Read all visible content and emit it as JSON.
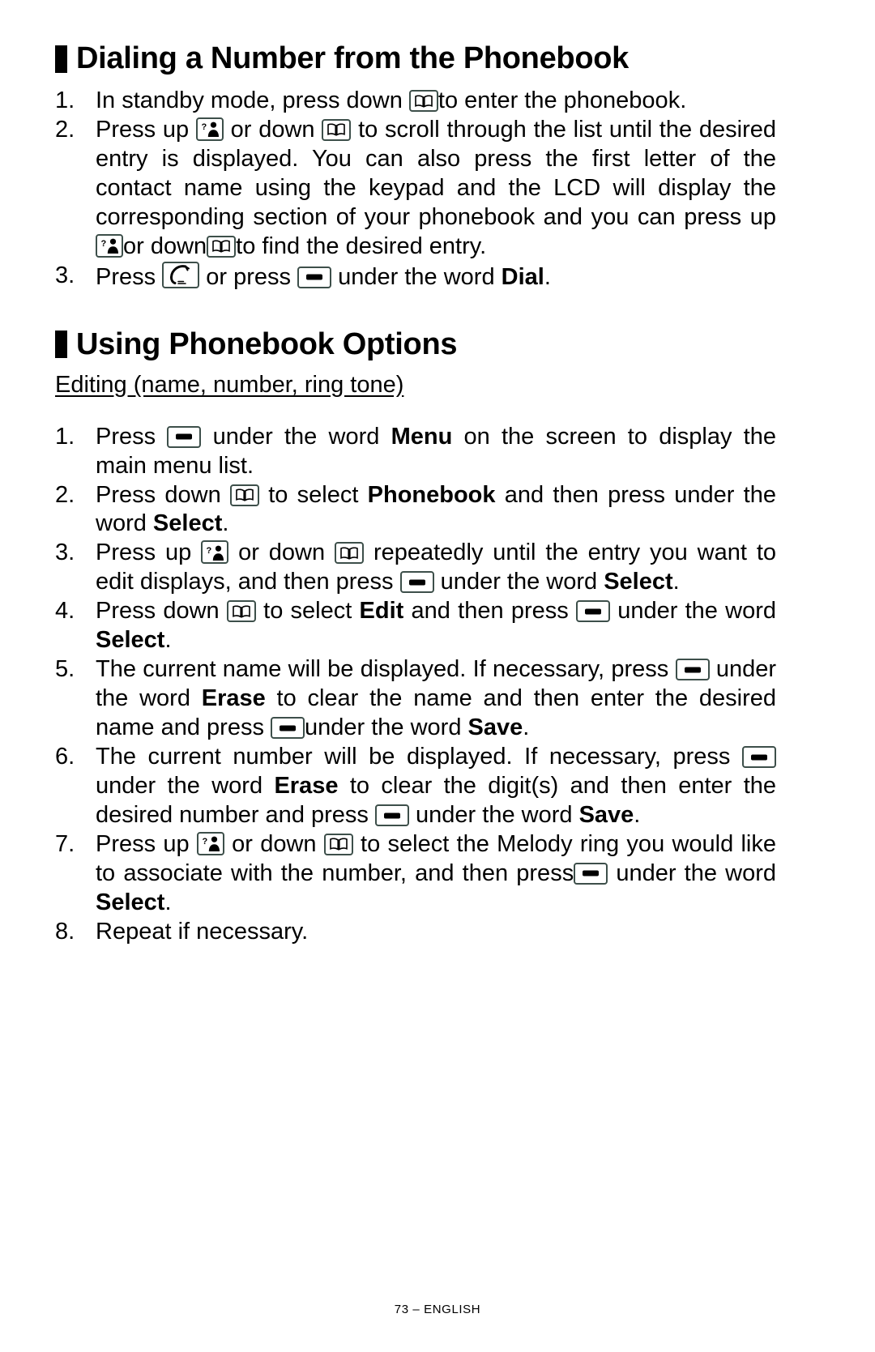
{
  "page": {
    "footer": "73 – ENGLISH"
  },
  "section1": {
    "heading": "Dialing a Number from the Phonebook",
    "steps": [
      {
        "num": "1.",
        "parts": [
          {
            "t": "text",
            "v": "In standby mode, press down "
          },
          {
            "t": "icon",
            "v": "phonebook-down-key"
          },
          {
            "t": "text",
            "v": "to enter the phonebook."
          }
        ]
      },
      {
        "num": "2.",
        "parts": [
          {
            "t": "text",
            "v": "Press up "
          },
          {
            "t": "icon",
            "v": "callerid-up-key"
          },
          {
            "t": "text",
            "v": " or down "
          },
          {
            "t": "icon",
            "v": "phonebook-down-key"
          },
          {
            "t": "text",
            "v": " to scroll through the list until the desired entry is displayed. You can also press the first letter of the contact name using the keypad and the LCD will display the corresponding section of your phonebook and you can press up"
          },
          {
            "t": "icon",
            "v": "callerid-up-key"
          },
          {
            "t": "text",
            "v": "or down"
          },
          {
            "t": "icon",
            "v": "phonebook-down-key"
          },
          {
            "t": "text",
            "v": "to find the desired entry."
          }
        ]
      },
      {
        "num": "3.",
        "parts": [
          {
            "t": "text",
            "v": "Press "
          },
          {
            "t": "icon",
            "v": "talk-key"
          },
          {
            "t": "text",
            "v": " or press "
          },
          {
            "t": "icon",
            "v": "soft-key"
          },
          {
            "t": "text",
            "v": " under the word "
          },
          {
            "t": "bold",
            "v": "Dial"
          },
          {
            "t": "text",
            "v": "."
          }
        ]
      }
    ]
  },
  "section2": {
    "heading": "Using Phonebook Options",
    "subheading": "Editing (name, number, ring tone)",
    "steps": [
      {
        "num": "1.",
        "parts": [
          {
            "t": "text",
            "v": "Press "
          },
          {
            "t": "icon",
            "v": "soft-key"
          },
          {
            "t": "text",
            "v": " under the word "
          },
          {
            "t": "bold",
            "v": "Menu"
          },
          {
            "t": "text",
            "v": " on the screen to display the main menu list."
          }
        ]
      },
      {
        "num": "2.",
        "parts": [
          {
            "t": "text",
            "v": "Press down "
          },
          {
            "t": "icon",
            "v": "phonebook-down-key"
          },
          {
            "t": "text",
            "v": " to select "
          },
          {
            "t": "bold",
            "v": "Phonebook"
          },
          {
            "t": "text",
            "v": " and then press under the word "
          },
          {
            "t": "bold",
            "v": "Select"
          },
          {
            "t": "text",
            "v": "."
          }
        ]
      },
      {
        "num": "3.",
        "parts": [
          {
            "t": "text",
            "v": "Press up "
          },
          {
            "t": "icon",
            "v": "callerid-up-key"
          },
          {
            "t": "text",
            "v": " or down "
          },
          {
            "t": "icon",
            "v": "phonebook-down-key"
          },
          {
            "t": "text",
            "v": " repeatedly until the entry you want to edit displays, and then press "
          },
          {
            "t": "icon",
            "v": "soft-key"
          },
          {
            "t": "text",
            "v": " under the word "
          },
          {
            "t": "bold",
            "v": "Select"
          },
          {
            "t": "text",
            "v": "."
          }
        ]
      },
      {
        "num": "4.",
        "parts": [
          {
            "t": "text",
            "v": "Press down "
          },
          {
            "t": "icon",
            "v": "phonebook-down-key"
          },
          {
            "t": "text",
            "v": " to select "
          },
          {
            "t": "bold",
            "v": "Edit"
          },
          {
            "t": "text",
            "v": " and then press "
          },
          {
            "t": "icon",
            "v": "soft-key"
          },
          {
            "t": "text",
            "v": " under the word "
          },
          {
            "t": "bold",
            "v": "Select"
          },
          {
            "t": "text",
            "v": "."
          }
        ]
      },
      {
        "num": "5.",
        "parts": [
          {
            "t": "text",
            "v": "The current name will be displayed. If necessary, press "
          },
          {
            "t": "icon",
            "v": "soft-key"
          },
          {
            "t": "text",
            "v": " under the word "
          },
          {
            "t": "bold",
            "v": "Erase"
          },
          {
            "t": "text",
            "v": " to clear the name and then enter the desired name and press "
          },
          {
            "t": "icon",
            "v": "soft-key"
          },
          {
            "t": "text",
            "v": "under the word "
          },
          {
            "t": "bold",
            "v": "Save"
          },
          {
            "t": "text",
            "v": "."
          }
        ]
      },
      {
        "num": "6.",
        "parts": [
          {
            "t": "text",
            "v": "The current number will be displayed.  If necessary, press "
          },
          {
            "t": "icon",
            "v": "soft-key"
          },
          {
            "t": "text",
            "v": "under the word "
          },
          {
            "t": "bold",
            "v": "Erase"
          },
          {
            "t": "text",
            "v": " to clear the digit(s) and then enter the desired number and press "
          },
          {
            "t": "icon",
            "v": "soft-key"
          },
          {
            "t": "text",
            "v": " under the word "
          },
          {
            "t": "bold",
            "v": "Save"
          },
          {
            "t": "text",
            "v": "."
          }
        ]
      },
      {
        "num": "7.",
        "parts": [
          {
            "t": "text",
            "v": "Press up "
          },
          {
            "t": "icon",
            "v": "callerid-up-key"
          },
          {
            "t": "text",
            "v": " or down "
          },
          {
            "t": "icon",
            "v": "phonebook-down-key"
          },
          {
            "t": "text",
            "v": " to select the Melody ring you would like to associate with the number, and then press"
          },
          {
            "t": "icon",
            "v": "soft-key"
          },
          {
            "t": "text",
            "v": " under the word "
          },
          {
            "t": "bold",
            "v": "Select"
          },
          {
            "t": "text",
            "v": "."
          }
        ]
      },
      {
        "num": "8.",
        "parts": [
          {
            "t": "text",
            "v": "Repeat if necessary."
          }
        ]
      }
    ]
  }
}
